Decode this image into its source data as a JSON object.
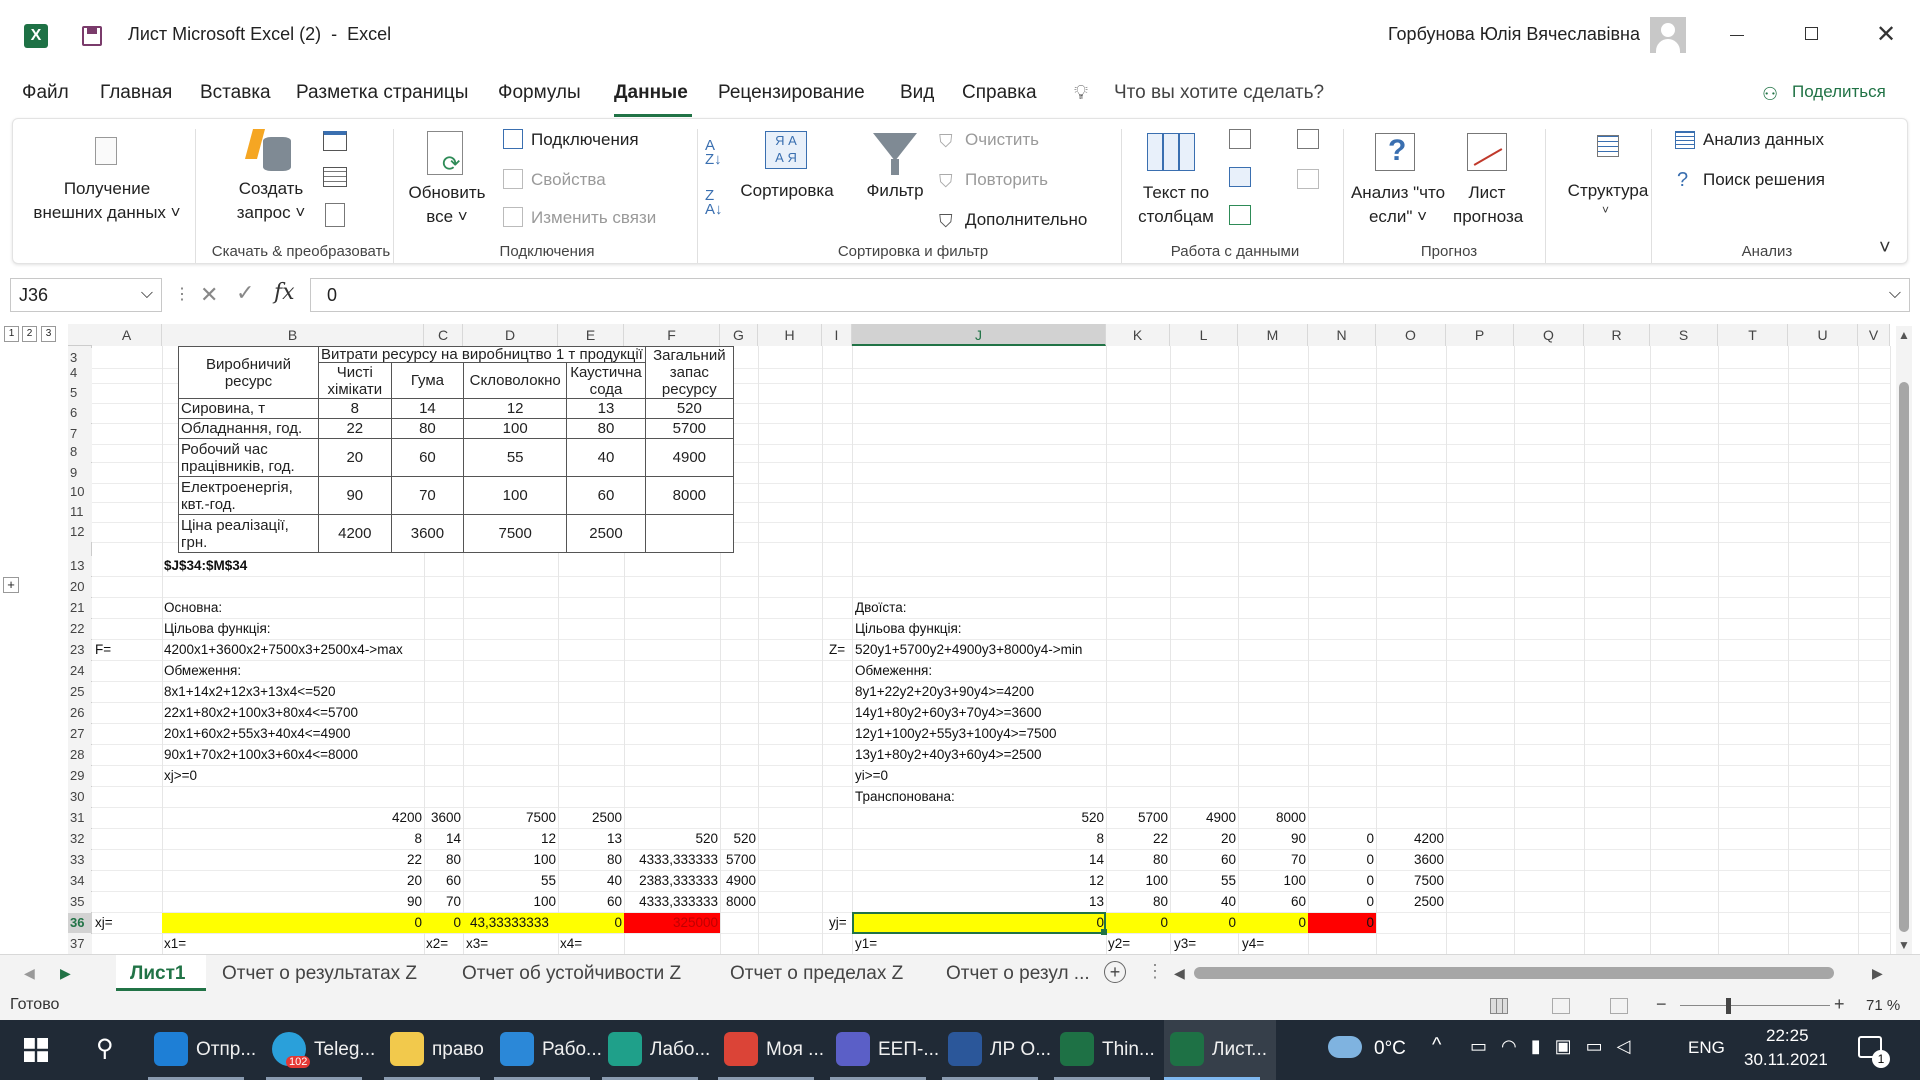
{
  "titlebar": {
    "doc_title": "Лист Microsoft Excel (2)  -  Excel",
    "user": "Горбунова Юлія Вячеславівна"
  },
  "tabs": [
    "Файл",
    "Главная",
    "Вставка",
    "Разметка страницы",
    "Формулы",
    "Данные",
    "Рецензирование",
    "Вид",
    "Справка"
  ],
  "tell_me": "Что вы хотите сделать?",
  "share": "Поделиться",
  "ribbon": {
    "get_external": [
      "Получение",
      "внешних данных ˅"
    ],
    "create_query": [
      "Создать",
      "запрос ˅"
    ],
    "group1": "Скачать & преобразовать",
    "refresh": [
      "Обновить",
      "все ˅"
    ],
    "connections": "Подключения",
    "properties": "Свойства",
    "edit_links": "Изменить связи",
    "group2": "Подключения",
    "sort": "Сортировка",
    "filter": "Фильтр",
    "clear": "Очистить",
    "reapply": "Повторить",
    "advanced": "Дополнительно",
    "group3": "Сортировка и фильтр",
    "text_to_columns": [
      "Текст по",
      "столбцам"
    ],
    "group4": "Работа с данными",
    "whatif": [
      "Анализ \"что",
      "если\" ˅"
    ],
    "forecast": [
      "Лист",
      "прогноза"
    ],
    "group5": "Прогноз",
    "outline": "Структура",
    "data_analysis": "Анализ данных",
    "solver": "Поиск решения",
    "group6": "Анализ"
  },
  "formula_bar": {
    "name_box": "J36",
    "formula": "0"
  },
  "outline_levels": [
    "1",
    "2",
    "3"
  ],
  "columns": [
    "A",
    "B",
    "C",
    "D",
    "E",
    "F",
    "G",
    "H",
    "I",
    "J",
    "K",
    "L",
    "M",
    "N",
    "O",
    "P",
    "Q",
    "R",
    "S",
    "T",
    "U",
    "V"
  ],
  "rows": [
    "3",
    "4",
    "5",
    "6",
    "7",
    "8",
    "9",
    "10",
    "11",
    "12",
    "13",
    "20",
    "21",
    "22",
    "23",
    "24",
    "25",
    "26",
    "27",
    "28",
    "29",
    "30",
    "31",
    "32",
    "33",
    "34",
    "35",
    "36",
    "37"
  ],
  "table": {
    "h_res": "Виробничий ресурс",
    "h_costs": "Витрати ресурсу на виробництво 1 т продукції",
    "h_stock": "Загальний запас ресурсу",
    "h_prod": [
      "Чисті хімікати",
      "Гума",
      "Скловолокно",
      "Каустична сода"
    ],
    "rows": [
      [
        "Сировина, т",
        "8",
        "14",
        "12",
        "13",
        "520"
      ],
      [
        "Обладнання, год.",
        "22",
        "80",
        "100",
        "80",
        "5700"
      ],
      [
        "Робочий час працівників, год.",
        "20",
        "60",
        "55",
        "40",
        "4900"
      ],
      [
        "Електроенергія, квт.-год.",
        "90",
        "70",
        "100",
        "60",
        "8000"
      ],
      [
        "Ціна реалізації, грн.",
        "4200",
        "3600",
        "7500",
        "2500",
        ""
      ]
    ]
  },
  "cells": {
    "b13": "$J$34:$M$34",
    "left": {
      "a23": "F=",
      "b21": "Основна:",
      "b22": "Цільова функція:",
      "b23": "4200x1+3600x2+7500x3+2500x4->max",
      "b24": "Обмеження:",
      "b25": "8x1+14x2+12x3+13x4<=520",
      "b26": "22x1+80x2+100x3+80x4<=5700",
      "b27": "20x1+60x2+55x3+40x4<=4900",
      "b28": "90x1+70x2+100x3+60x4<=8000",
      "b29": "xj>=0"
    },
    "right": {
      "i23": "Z=",
      "j21": "Двоїста:",
      "j22": "Цільова функція:",
      "j23": "520y1+5700y2+4900y3+8000y4->min",
      "j24": "Обмеження:",
      "j25": "8y1+22y2+20y3+90y4>=4200",
      "j26": "14y1+80y2+60y3+70y4>=3600",
      "j27": "12y1+100y2+55y3+100y4>=7500",
      "j28": "13y1+80y2+40y3+60y4>=2500",
      "j29": "yi>=0",
      "j30": "Транспонована:"
    },
    "r31L": [
      "4200",
      "3600",
      "7500",
      "2500"
    ],
    "r32L": [
      "8",
      "14",
      "12",
      "13",
      "520",
      "520"
    ],
    "r33L": [
      "22",
      "80",
      "100",
      "80",
      "4333,333333",
      "5700"
    ],
    "r34L": [
      "20",
      "60",
      "55",
      "40",
      "2383,333333",
      "4900"
    ],
    "r35L": [
      "90",
      "70",
      "100",
      "60",
      "4333,333333",
      "8000"
    ],
    "r31R": [
      "520",
      "5700",
      "4900",
      "8000"
    ],
    "r32R": [
      "8",
      "22",
      "20",
      "90",
      "0",
      "4200"
    ],
    "r33R": [
      "14",
      "80",
      "60",
      "70",
      "0",
      "3600"
    ],
    "r34R": [
      "12",
      "100",
      "55",
      "100",
      "0",
      "7500"
    ],
    "r35R": [
      "13",
      "80",
      "40",
      "60",
      "0",
      "2500"
    ],
    "a36": "xj=",
    "r36L": [
      "0",
      "0",
      "43,33333333",
      "0",
      "325000"
    ],
    "i36": "yj=",
    "r36R": [
      "0",
      "0",
      "0",
      "0",
      "0"
    ],
    "r37L": [
      "x1=",
      "x2=",
      "x3=",
      "x4="
    ],
    "r37R": [
      "y1=",
      "y2=",
      "y3=",
      "y4="
    ]
  },
  "sheet_tabs": [
    "Лист1",
    "Отчет о результатах Z",
    "Отчет об устойчивости Z",
    "Отчет о пределах Z",
    "Отчет о резул ..."
  ],
  "status": {
    "ready": "Готово",
    "zoom": "71 %"
  },
  "taskbar": {
    "items": [
      "Отпр...",
      "Teleg...",
      "право",
      "Рабо...",
      "Лабо...",
      "Моя ...",
      "ЕЕП-...",
      "ЛР О...",
      "Thin...",
      "Лист..."
    ],
    "badge": "102",
    "weather": "0°C",
    "lang": "ENG",
    "time": "22:25",
    "date": "30.11.2021",
    "notif": "1"
  },
  "colors": {
    "yellow": "#ffff00",
    "red": "#ff0000",
    "excel_green": "#1e7145",
    "accent": "#217346"
  }
}
